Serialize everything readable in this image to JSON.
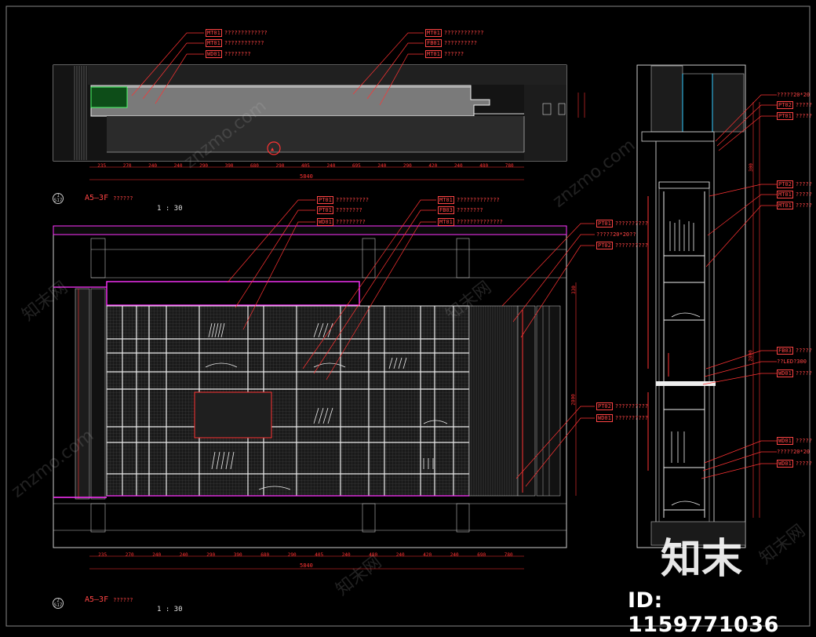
{
  "drawing": {
    "plan_view": {
      "title": "A5—3F",
      "subtitle": "??????",
      "scale": "1 : 30",
      "marker_top": "1",
      "marker_bottom": "S17",
      "dims": [
        "235",
        "270",
        "240",
        "240",
        "290",
        "390",
        "680",
        "290",
        "405",
        "240",
        "695",
        "240",
        "290",
        "420",
        "240",
        "480",
        "780"
      ],
      "overall": "5840",
      "tags": [
        {
          "code": "MT01",
          "text": "?????????????"
        },
        {
          "code": "MT01",
          "text": "????????????"
        },
        {
          "code": "WD01",
          "text": "????????"
        },
        {
          "code": "MT01",
          "text": "????????????"
        },
        {
          "code": "FB01",
          "text": "??????????"
        },
        {
          "code": "MT01",
          "text": "??????"
        }
      ]
    },
    "elevation_view": {
      "title": "A5—3F",
      "subtitle": "??????",
      "scale": "1 : 30",
      "marker_top": "2",
      "marker_bottom": "S17",
      "dims": [
        "235",
        "270",
        "240",
        "240",
        "290",
        "390",
        "680",
        "290",
        "405",
        "240",
        "480",
        "240",
        "420",
        "240",
        "690",
        "780"
      ],
      "overall": "5840",
      "height_dims": [
        "330",
        "2800"
      ],
      "tags": [
        {
          "code": "PT01",
          "text": "??????????"
        },
        {
          "code": "PT01",
          "text": "????????"
        },
        {
          "code": "WD01",
          "text": "?????????"
        },
        {
          "code": "MT01",
          "text": "?????????????"
        },
        {
          "code": "FB03",
          "text": "????????"
        },
        {
          "code": "MT01",
          "text": "??????????????"
        },
        {
          "code": "PT01",
          "text": "??????????"
        },
        {
          "code": "",
          "text": "?????20*20??"
        },
        {
          "code": "PT02",
          "text": "??????????"
        },
        {
          "code": "PT02",
          "text": "??????????"
        },
        {
          "code": "WD01",
          "text": "??????????"
        }
      ]
    },
    "section_view": {
      "height_dims": [
        "300",
        "2800"
      ],
      "tags": [
        {
          "code": "",
          "text": "?????20*20"
        },
        {
          "code": "PT02",
          "text": "?????"
        },
        {
          "code": "PT01",
          "text": "?????"
        },
        {
          "code": "PT02",
          "text": "?????"
        },
        {
          "code": "MT01",
          "text": "?????"
        },
        {
          "code": "MT01",
          "text": "?????"
        },
        {
          "code": "FB03",
          "text": "?????"
        },
        {
          "code": "",
          "text": "??LED?300"
        },
        {
          "code": "WD01",
          "text": "?????"
        },
        {
          "code": "WD01",
          "text": "?????"
        },
        {
          "code": "",
          "text": "?????20*20"
        },
        {
          "code": "WD01",
          "text": "?????"
        }
      ]
    }
  },
  "watermark": {
    "logo": "知末",
    "id_label": "ID: 1159771036",
    "site": "znzmo.com",
    "site_cn": "知末网"
  }
}
